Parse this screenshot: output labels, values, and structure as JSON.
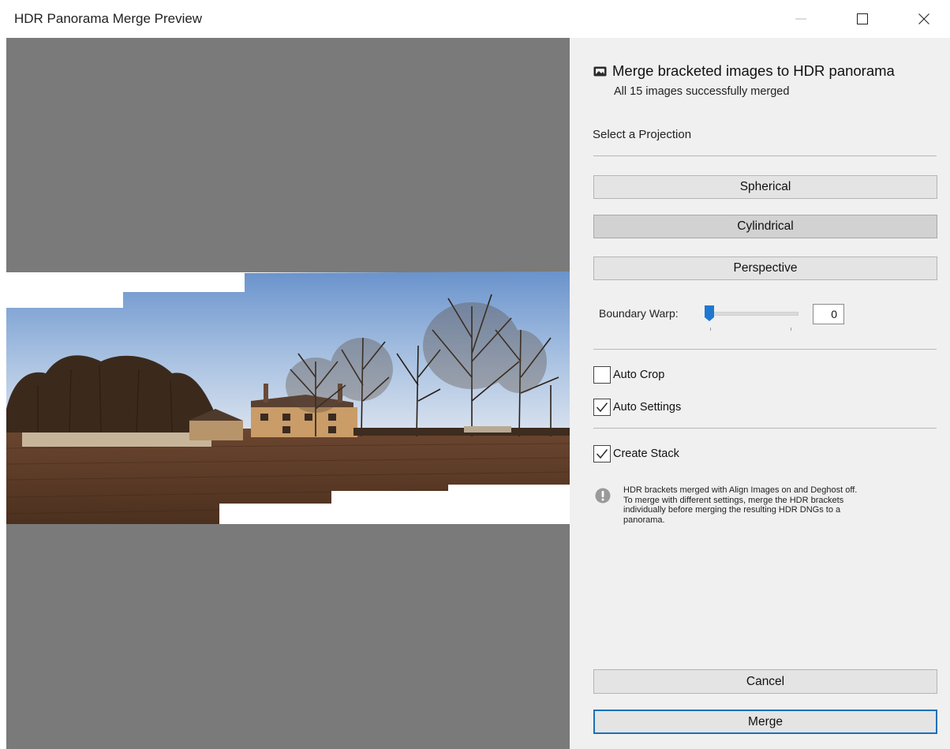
{
  "window": {
    "title": "HDR Panorama Merge Preview",
    "controls": [
      "minimize-icon",
      "maximize-icon",
      "close-icon"
    ]
  },
  "header": {
    "icon": "panorama-photo-icon",
    "title": "Merge bracketed images to HDR panorama",
    "subtitle": "All 15 images successfully merged"
  },
  "projection": {
    "label": "Select a Projection",
    "options": [
      "Spherical",
      "Cylindrical",
      "Perspective"
    ],
    "selected": "Cylindrical"
  },
  "boundary_warp": {
    "label": "Boundary Warp:",
    "value": "0"
  },
  "options": {
    "auto_crop": {
      "label": "Auto Crop",
      "checked": false
    },
    "auto_settings": {
      "label": "Auto Settings",
      "checked": true
    },
    "create_stack": {
      "label": "Create Stack",
      "checked": true
    }
  },
  "info": {
    "icon": "warning-icon",
    "text": "HDR brackets merged with Align Images on and Deghost off. To merge with different settings, merge the HDR brackets individually before merging the resulting HDR DNGs to a panorama."
  },
  "buttons": {
    "cancel": "Cancel",
    "merge": "Merge"
  },
  "colors": {
    "preview_background": "#7a7a7a",
    "panel_background": "#f0f0f0",
    "accent": "#1c70b8"
  }
}
